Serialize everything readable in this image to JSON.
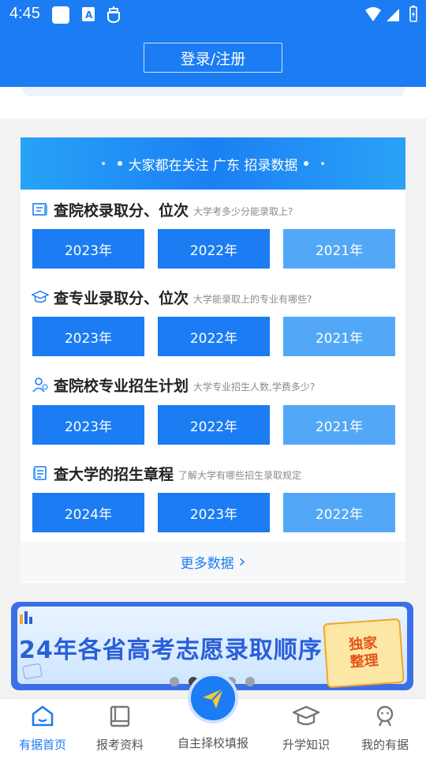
{
  "status_bar": {
    "time": "4:45"
  },
  "header": {
    "login_label": "登录/注册"
  },
  "card": {
    "banner_text": "大家都在关注 广东 招录数据",
    "sections": [
      {
        "icon": "school-icon",
        "title": "查院校录取分、位次",
        "subtitle": "大学考多少分能录取上?",
        "years": [
          "2023年",
          "2022年",
          "2021年"
        ]
      },
      {
        "icon": "graduation-cap-icon",
        "title": "查专业录取分、位次",
        "subtitle": "大学能录取上的专业有哪些?",
        "years": [
          "2023年",
          "2022年",
          "2021年"
        ]
      },
      {
        "icon": "people-icon",
        "title": "查院校专业招生计划",
        "subtitle": "大学专业招生人数,学费多少?",
        "years": [
          "2023年",
          "2022年",
          "2021年"
        ]
      },
      {
        "icon": "document-icon",
        "title": "查大学的招生章程",
        "subtitle": "了解大学有哪些招生录取规定",
        "years": [
          "2024年",
          "2023年",
          "2022年"
        ]
      }
    ],
    "more_label": "更多数据",
    "more_chevron": "›"
  },
  "ad": {
    "headline": "24年各省高考志愿录取顺序",
    "badge_line1": "独家",
    "badge_line2": "整理"
  },
  "bottom_nav": [
    {
      "label": "有据首页",
      "icon": "home-icon",
      "active": true
    },
    {
      "label": "报考资料",
      "icon": "book-icon",
      "active": false
    },
    {
      "label": "自主择校填报",
      "icon": "paper-plane-icon",
      "active": false
    },
    {
      "label": "升学知识",
      "icon": "graduation-cap-icon",
      "active": false
    },
    {
      "label": "我的有据",
      "icon": "user-icon",
      "active": false
    }
  ],
  "colors": {
    "primary": "#1b7cf3",
    "light_button": "#52a8f7"
  }
}
